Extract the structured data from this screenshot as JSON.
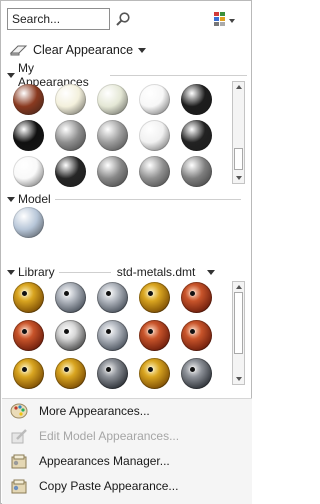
{
  "search": {
    "placeholder": "Search...",
    "value": "Search..."
  },
  "toolbar": {
    "clear_label": "Clear Appearance"
  },
  "my_appearances": {
    "title": "My Appearances",
    "balls": [
      "#8a3a20",
      "#f3f0dc",
      "#e4e7d5",
      "#f7f7f7",
      "#1d1d1d",
      "#101010",
      "#8f8f8f",
      "#9d9d9d",
      "#f1f1f1",
      "#222222",
      "#f9f9f9",
      "#262626",
      "#888888",
      "#909090",
      "#7e7e7e"
    ],
    "colors": {
      "accent": "#333333"
    }
  },
  "model": {
    "title": "Model",
    "balls": [
      "#b7c6d8"
    ]
  },
  "library": {
    "title": "Library",
    "name": "std-metals.dmt",
    "balls": [
      "gold",
      "silver",
      "silver",
      "gold",
      "copper",
      "copper",
      "chrome",
      "silver",
      "copper",
      "copper",
      "gold",
      "gold",
      "darksilver",
      "gold",
      "darksilver"
    ]
  },
  "menu": {
    "items": [
      {
        "label": "More Appearances...",
        "enabled": true,
        "icon": "palette-icon"
      },
      {
        "label": "Edit Model Appearances...",
        "enabled": false,
        "icon": "edit-appearance-icon"
      },
      {
        "label": "Appearances Manager...",
        "enabled": true,
        "icon": "appearances-manager-icon"
      },
      {
        "label": "Copy Paste Appearance...",
        "enabled": true,
        "icon": "copy-paste-icon"
      }
    ]
  }
}
